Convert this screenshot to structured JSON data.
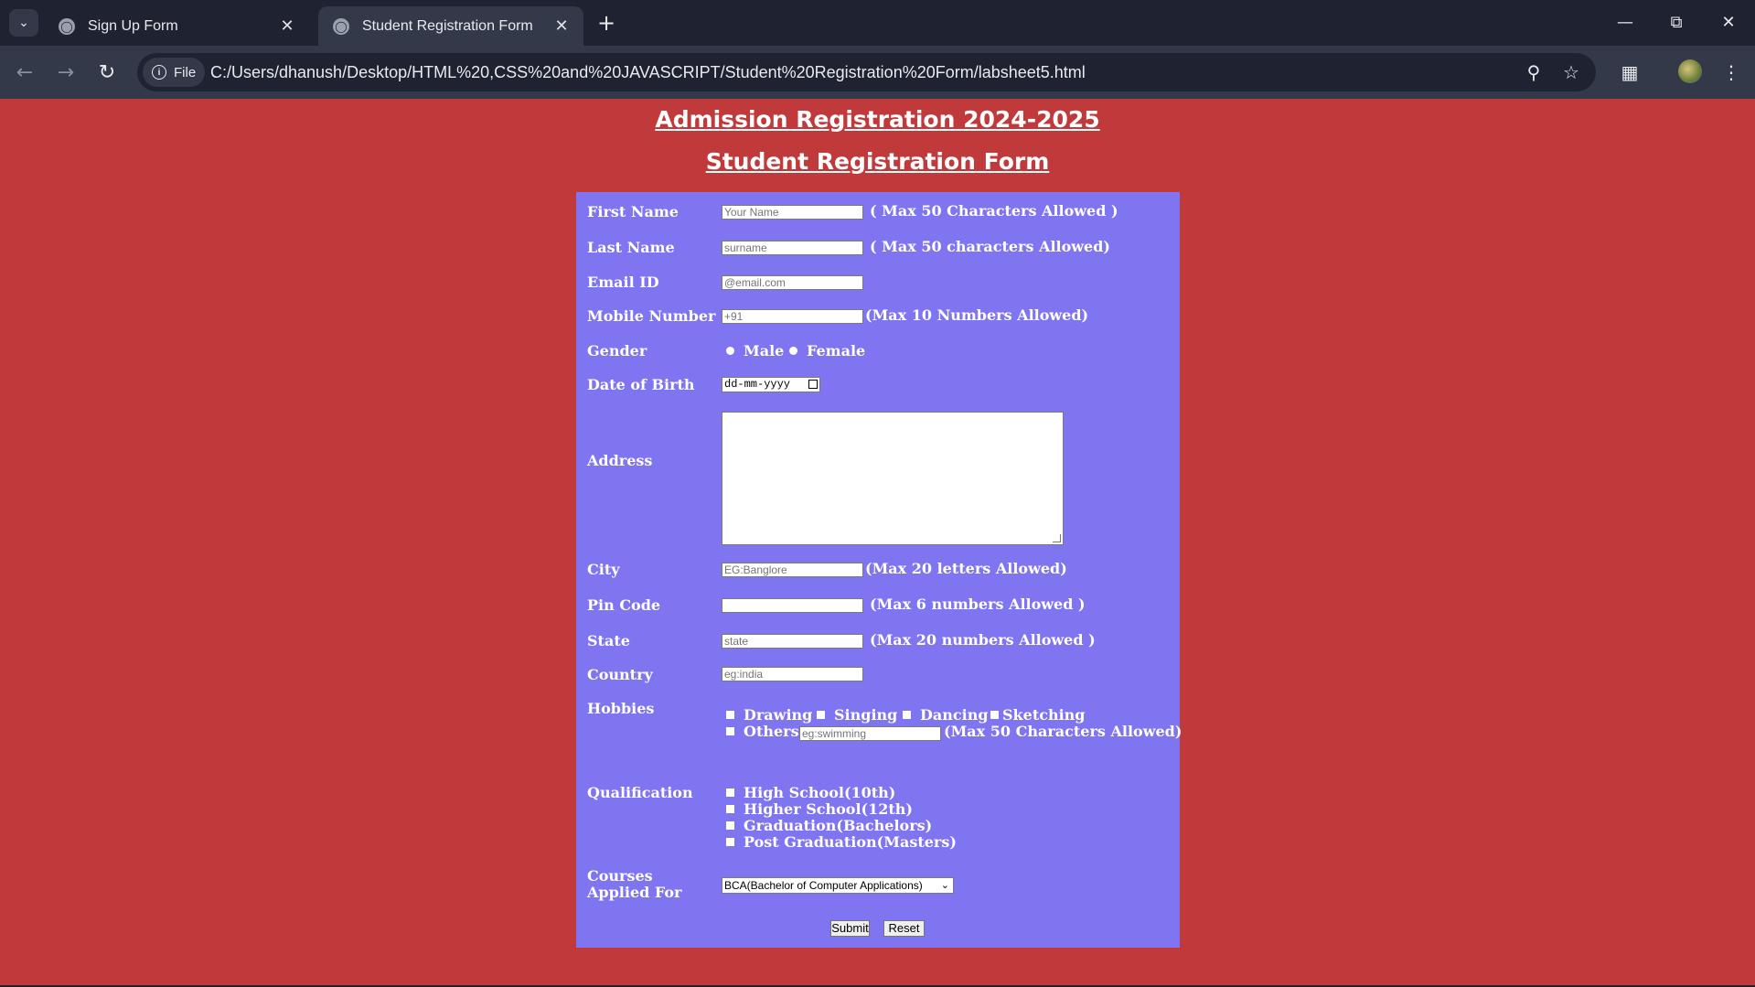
{
  "browser": {
    "tabs": [
      {
        "title": "Sign Up Form",
        "active": false
      },
      {
        "title": "Student Registration Form",
        "active": true
      }
    ],
    "url_chip": "File",
    "url": "C:/Users/dhanush/Desktop/HTML%20,CSS%20and%20JAVASCRIPT/Student%20Registration%20Form/labsheet5.html"
  },
  "page": {
    "heading1": "Admission Registration 2024-2025",
    "heading2": "Student Registration Form"
  },
  "form": {
    "first_name": {
      "label": "First Name",
      "placeholder": "Your Name",
      "hint": "( Max 50 Characters Allowed )"
    },
    "last_name": {
      "label": "Last Name",
      "placeholder": "surname",
      "hint": "( Max 50 characters Allowed)"
    },
    "email": {
      "label": "Email ID",
      "placeholder": "@email.com"
    },
    "mobile": {
      "label": "Mobile Number",
      "placeholder": "+91",
      "hint": "(Max 10 Numbers Allowed)"
    },
    "gender": {
      "label": "Gender",
      "options": [
        "Male",
        "Female"
      ]
    },
    "dob": {
      "label": "Date of Birth",
      "placeholder": "dd-mm-yyyy"
    },
    "address": {
      "label": "Address"
    },
    "city": {
      "label": "City",
      "placeholder": "EG:Banglore",
      "hint": "(Max 20 letters Allowed)"
    },
    "pincode": {
      "label": "Pin Code",
      "placeholder": "",
      "hint": "(Max 6 numbers Allowed )"
    },
    "state": {
      "label": "State",
      "placeholder": "state",
      "hint": "(Max 20 numbers Allowed )"
    },
    "country": {
      "label": "Country",
      "placeholder": "eg:india"
    },
    "hobbies": {
      "label": "Hobbies",
      "options": [
        "Drawing",
        "Singing",
        "Dancing",
        "Sketching"
      ],
      "others_label": "Others",
      "others_placeholder": "eg:swimming",
      "others_hint": "(Max 50 Characters Allowed)"
    },
    "qualification": {
      "label": "Qualification",
      "options": [
        "High School(10th)",
        "Higher School(12th)",
        "Graduation(Bachelors)",
        "Post Graduation(Masters)"
      ]
    },
    "courses": {
      "label_line1": "Courses",
      "label_line2": "Applied For",
      "selected": "BCA(Bachelor of Computer Applications)"
    },
    "submit_label": "Submit",
    "reset_label": "Reset"
  },
  "colors": {
    "page_bg": "#c0393b",
    "form_bg": "#8075f0",
    "chrome_dark": "#1f2331",
    "chrome_mid": "#343949"
  }
}
